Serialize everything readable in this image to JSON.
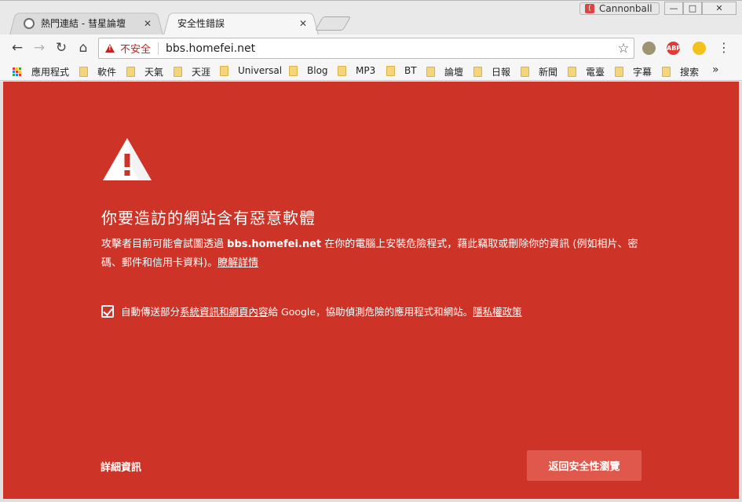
{
  "tabs": [
    {
      "title": "熱門連結 - 彗星論壇",
      "close": "✕",
      "active": false
    },
    {
      "title": "安全性錯誤",
      "close": "✕",
      "active": true
    }
  ],
  "window": {
    "profile_name": "Cannonball",
    "minimize": "—",
    "maximize": "□",
    "close": "✕"
  },
  "toolbar": {
    "back": "←",
    "forward": "→",
    "reload": "↻",
    "home": "⌂",
    "security_label": "不安全",
    "url": "bbs.homefei.net",
    "bookmark_star": "☆",
    "ext_abp_label": "ABP",
    "menu": "⋮"
  },
  "bookmarks": {
    "apps_label": "應用程式",
    "items": [
      "軟件",
      "天氣",
      "天涯",
      "Universal",
      "Blog",
      "MP3",
      "BT",
      "論壇",
      "日報",
      "新聞",
      "電臺",
      "字幕",
      "搜索"
    ],
    "overflow": "»"
  },
  "interstitial": {
    "headline": "你要造訪的網站含有惡意軟體",
    "body_before": "攻擊者目前可能會試圖透過 ",
    "body_domain": "bbs.homefei.net",
    "body_after": " 在你的電腦上安裝危險程式，藉此竊取或刪除你的資訊 (例如相片、密碼、郵件和信用卡資料)。",
    "learn_more": "瞭解詳情",
    "optin_before": "自動傳送部分",
    "optin_link": "系統資訊和網頁內容",
    "optin_middle": "給 Google，協助偵測危險的應用程式和網站。",
    "privacy_link": "隱私權政策",
    "optin_checked": true,
    "details_button": "詳細資訊",
    "back_button": "返回安全性瀏覽",
    "background_color": "#cd3427"
  }
}
